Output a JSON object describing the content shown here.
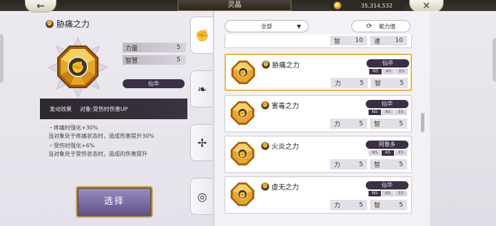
{
  "header": {
    "back_icon": "←",
    "title": "灵晶",
    "currency_icon": "coin-icon",
    "currency_value": "35,314,532",
    "close_icon": "✕"
  },
  "detail": {
    "name": "胁痛之力",
    "stats": [
      {
        "label": "力量",
        "value": "5"
      },
      {
        "label": "智慧",
        "value": "5"
      }
    ],
    "class_badge": "仙华",
    "effect_label": "发动效果",
    "effect_target": "对象:受伤时伤害UP",
    "effects": [
      {
        "title": "・疼痛时强化+30%",
        "desc": "当对象处于疼痛状态时，造成伤害提升30%"
      },
      {
        "title": "・受伤时强化+6%",
        "desc": "当对象处于受伤状态时，造成的伤害提升"
      }
    ],
    "select_label": "选择"
  },
  "tabs": [
    {
      "icon": "fist-icon",
      "glyph": "✊",
      "active": true
    },
    {
      "icon": "swirl-icon",
      "glyph": "❧",
      "active": false
    },
    {
      "icon": "cross-sword-icon",
      "glyph": "✢",
      "active": false
    },
    {
      "icon": "vortex-icon",
      "glyph": "◎",
      "active": false
    }
  ],
  "list": {
    "filter_label": "全部",
    "sort_label": "能力值",
    "partial_row": {
      "stat1_label": "智",
      "stat1_value": "10",
      "stat2_label": "速",
      "stat2_value": "10"
    },
    "items": [
      {
        "name": "胁痛之力",
        "class": "仙华",
        "attrs": [
          "NS",
          "AS",
          "ES"
        ],
        "attr_on": [
          0
        ],
        "stat1_label": "力",
        "stat1_value": "5",
        "stat2_label": "智",
        "stat2_value": "5",
        "selected": true
      },
      {
        "name": "害毒之力",
        "class": "仙华",
        "attrs": [
          "NS",
          "AS",
          "ES"
        ],
        "attr_on": [
          0
        ],
        "stat1_label": "力",
        "stat1_value": "5",
        "stat2_label": "智",
        "stat2_value": "5",
        "selected": false
      },
      {
        "name": "火炎之力",
        "class": "阿鲁多",
        "attrs": [
          "NS",
          "AS",
          "ES"
        ],
        "attr_on": [
          1
        ],
        "stat1_label": "力",
        "stat1_value": "5",
        "stat2_label": "智",
        "stat2_value": "5",
        "selected": false
      },
      {
        "name": "虚无之力",
        "class": "仙华",
        "attrs": [
          "NS",
          "AS",
          "ES"
        ],
        "attr_on": [
          0
        ],
        "stat1_label": "力",
        "stat1_value": "5",
        "stat2_label": "智",
        "stat2_value": "5",
        "selected": false
      }
    ]
  },
  "colors": {
    "gem_gold": "#e8a628",
    "gem_dark": "#a55f0c",
    "badge_dark": "#3a2f45",
    "select_accent": "#e7b64a"
  }
}
